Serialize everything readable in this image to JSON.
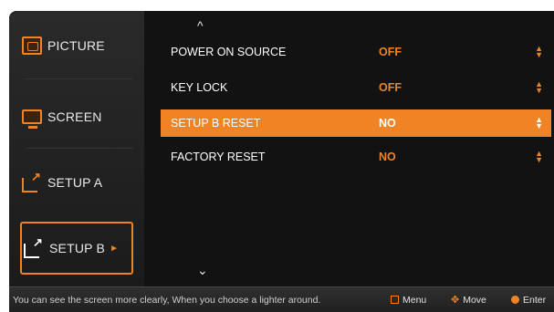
{
  "sidebar": {
    "items": [
      {
        "label": "PICTURE",
        "icon": "picture-icon"
      },
      {
        "label": "SCREEN",
        "icon": "screen-icon"
      },
      {
        "label": "SETUP A",
        "icon": "setup-a-icon"
      },
      {
        "label": "SETUP B",
        "icon": "setup-b-icon",
        "active": true,
        "arrow": "►"
      }
    ]
  },
  "main": {
    "scroll_up": "^",
    "scroll_down": "⌄",
    "rows": [
      {
        "label": "POWER ON SOURCE",
        "value": "OFF"
      },
      {
        "label": "KEY LOCK",
        "value": "OFF"
      },
      {
        "label": "SETUP B RESET",
        "value": "NO",
        "selected": true
      },
      {
        "label": "FACTORY RESET",
        "value": "NO"
      }
    ],
    "spinner": "▲\n▼"
  },
  "bottombar": {
    "hint": "You can see the screen more clearly, When you choose a lighter around.",
    "keys": {
      "menu": "Menu",
      "move": "Move",
      "enter": "Enter"
    }
  },
  "colors": {
    "accent": "#f08424",
    "background": "#131313",
    "text": "#ffffff"
  }
}
